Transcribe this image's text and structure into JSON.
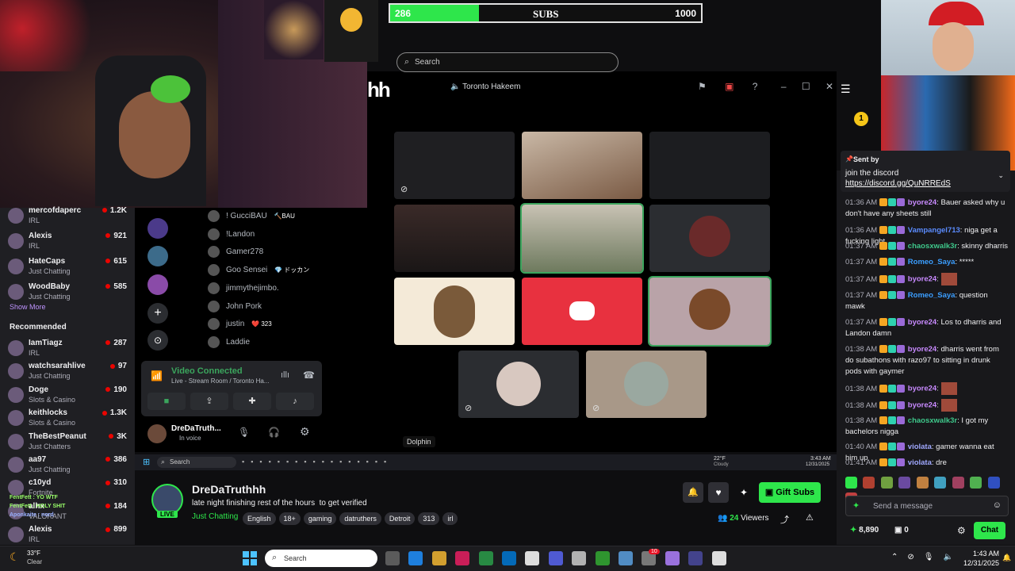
{
  "subs_bar": {
    "current": "286",
    "label": "SUBS",
    "goal": "1000",
    "progress": 0.286
  },
  "discord": {
    "search_placeholder": "Search",
    "window_title": "Toronto Hakeem",
    "logo_text": "hh",
    "tooltip": "Dolphin",
    "voice_connected": "Video Connected",
    "voice_channel": "Live - Stream Room / Toronto Ha...",
    "user_name": "DreDaTruth...",
    "user_status": "In voice",
    "channel_users": [
      {
        "name": "! GucciBAU",
        "tag": "🔨BAU"
      },
      {
        "name": "!Landon",
        "tag": ""
      },
      {
        "name": "Gamer278",
        "tag": ""
      },
      {
        "name": "Goo Sensei",
        "tag": "💎 ドッカン"
      },
      {
        "name": "jimmythejimbo.",
        "tag": ""
      },
      {
        "name": "John Pork",
        "tag": ""
      },
      {
        "name": "justin",
        "tag": "❤️ 323"
      },
      {
        "name": "Laddie",
        "tag": ""
      }
    ]
  },
  "win_taskbar_inner": {
    "search": "Search",
    "weather": "22°F",
    "weather_sub": "Cloudy",
    "time": "3:43 AM",
    "date": "12/31/2025"
  },
  "sidebar": {
    "followed": [
      {
        "name": "mercofdaperc",
        "category": "IRL",
        "viewers": "1.2K"
      },
      {
        "name": "Alexis",
        "category": "IRL",
        "viewers": "921"
      },
      {
        "name": "HateCaps",
        "category": "Just Chatting",
        "viewers": "615"
      },
      {
        "name": "WoodBaby",
        "category": "Just Chatting",
        "viewers": "585"
      }
    ],
    "show_more": "Show More",
    "recommended_title": "Recommended",
    "recommended": [
      {
        "name": "IamTiagz",
        "category": "IRL",
        "viewers": "287"
      },
      {
        "name": "watchsarahlive",
        "category": "Just Chatting",
        "viewers": "97"
      },
      {
        "name": "Doge",
        "category": "Slots & Casino",
        "viewers": "190"
      },
      {
        "name": "keithlocks",
        "category": "Slots & Casino",
        "viewers": "1.3K"
      },
      {
        "name": "TheBestPeanut",
        "category": "Just Chatters",
        "viewers": "3K"
      },
      {
        "name": "aa97",
        "category": "Just Chatting",
        "viewers": "386"
      },
      {
        "name": "c10yd",
        "category": "Fortnite",
        "viewers": "310"
      },
      {
        "name": "alhx",
        "category": "VALORANT",
        "viewers": "184"
      },
      {
        "name": "Alexis",
        "category": "IRL",
        "viewers": "899"
      }
    ],
    "overlay_chat": [
      "FentFett : YO WTF",
      "FentFett : HOLY SHIT",
      "Aponkaite : nord"
    ]
  },
  "stream_info": {
    "channel": "DreDaTruthhh",
    "live": "LIVE",
    "title": "late night finishing rest of the hours  to get verified",
    "category": "Just Chatting",
    "tags": [
      "English",
      "18+",
      "gaming",
      "datruthers",
      "Detroit",
      "313",
      "irl"
    ],
    "viewers_count": "24",
    "viewers_label": "Viewers",
    "gift_subs": "Gift Subs"
  },
  "chat": {
    "pinned_rank": "1",
    "pinned_sent_by": "Sent by",
    "pinned_text": "join the discord",
    "pinned_link": "https://discord.gg/QuNRREdS",
    "messages": [
      {
        "time": "01:36 AM",
        "user": "byore24",
        "color": "#c88aff",
        "text": "Bauer asked why u don't have any sheets still"
      },
      {
        "time": "01:36 AM",
        "user": "Vampangel713",
        "color": "#5b8cff",
        "text": "niga get a fucking light"
      },
      {
        "time": "01:37 AM",
        "user": "chaosxwalk3r",
        "color": "#3ec78a",
        "text": "skinny dharris"
      },
      {
        "time": "01:37 AM",
        "user": "Romeo_Saya",
        "color": "#3b9eff",
        "text": "*****"
      },
      {
        "time": "01:37 AM",
        "user": "byore24",
        "color": "#c88aff",
        "text": ""
      },
      {
        "time": "01:37 AM",
        "user": "Romeo_Saya",
        "color": "#3b9eff",
        "text": "question mawk"
      },
      {
        "time": "01:37 AM",
        "user": "byore24",
        "color": "#c88aff",
        "text": "Los to dharris and Landon damn"
      },
      {
        "time": "01:38 AM",
        "user": "byore24",
        "color": "#c88aff",
        "text": "dharris went from do subathons with razo97 to sitting in drunk pods with gaymer"
      },
      {
        "time": "01:38 AM",
        "user": "byore24",
        "color": "#c88aff",
        "text": ""
      },
      {
        "time": "01:38 AM",
        "user": "byore24",
        "color": "#c88aff",
        "text": ""
      },
      {
        "time": "01:38 AM",
        "user": "chaosxwalk3r",
        "color": "#3ec78a",
        "text": "I got my bachelors nigga"
      },
      {
        "time": "01:40 AM",
        "user": "violata",
        "color": "#a0a8ff",
        "text": "gamer wanna eat him up"
      },
      {
        "time": "01:41 AM",
        "user": "violata",
        "color": "#a0a8ff",
        "text": "dre"
      }
    ],
    "input_placeholder": "Send a message",
    "points": "8,890",
    "drops": "0",
    "chat_button": "Chat"
  },
  "os_taskbar": {
    "search": "Search",
    "time": "1:43 AM",
    "date": "12/31/2025",
    "temp": "33°F",
    "weather": "Clear",
    "notif_badge": "10"
  }
}
